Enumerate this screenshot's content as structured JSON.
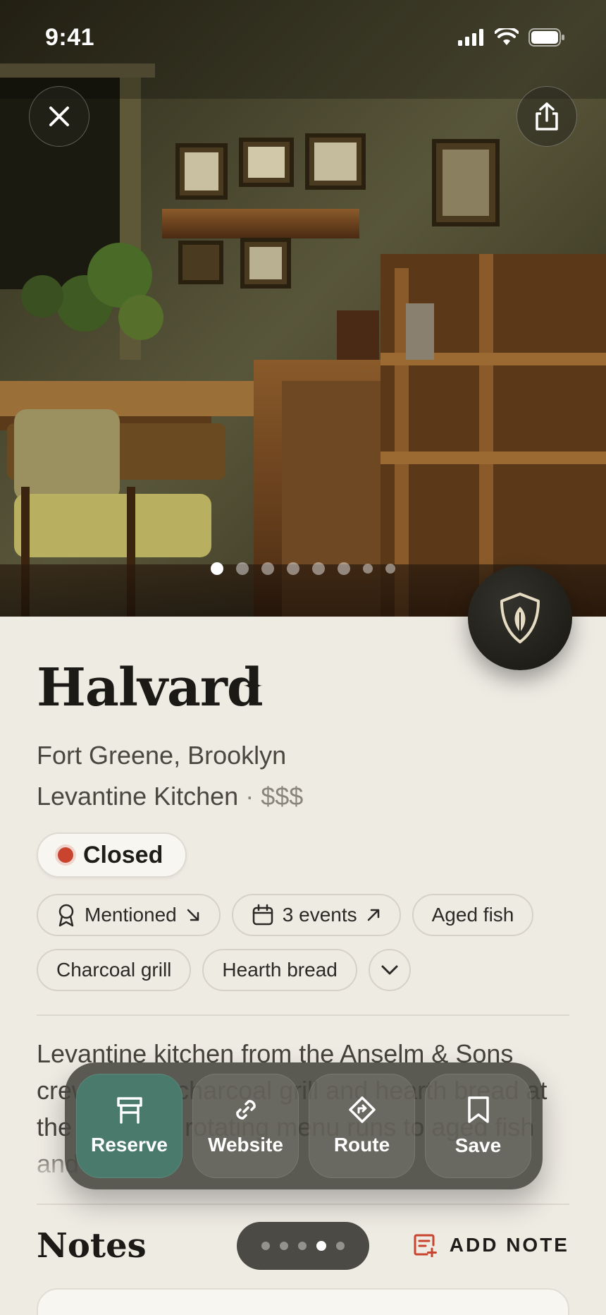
{
  "status": {
    "time": "9:41"
  },
  "gallery": {
    "count": 8,
    "active": 0
  },
  "restaurant": {
    "name": "Halvard",
    "location": "Fort Greene, Brooklyn",
    "cuisine": "Levantine Kitchen",
    "separator": "·",
    "price": "$$$",
    "status": "Closed",
    "status_color": "#c8442f"
  },
  "chips": {
    "mentioned": "Mentioned",
    "events": "3 events",
    "tags": [
      "Aged fish",
      "Charcoal grill",
      "Hearth bread"
    ]
  },
  "description": "Levantine kitchen from the Anselm & Sons crew, with a charcoal grill and hearth bread at the center; a rotating menu runs to aged fish and",
  "actions": {
    "reserve": "Reserve",
    "website": "Website",
    "route": "Route",
    "save": "Save"
  },
  "notes": {
    "title": "Notes",
    "add_label": "ADD NOTE"
  },
  "pager": {
    "count": 5,
    "active": 3
  },
  "colors": {
    "accent": "#4a7a6c",
    "add_note": "#c8442f",
    "background": "#eeebe3"
  }
}
